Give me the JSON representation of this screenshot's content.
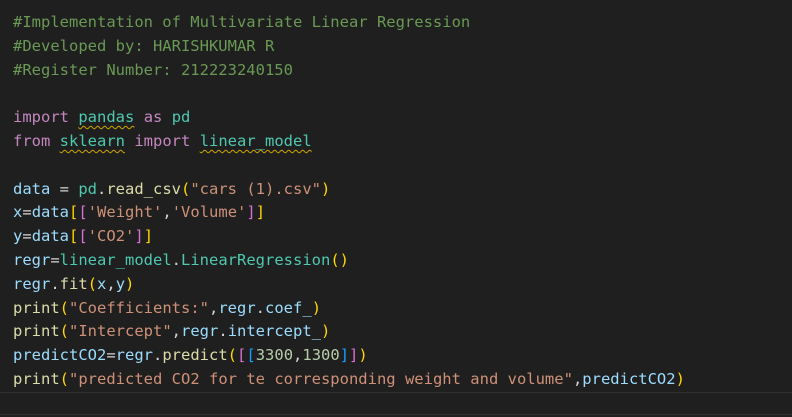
{
  "editor": {
    "lines": [
      [
        {
          "t": "#Implementation of Multivariate Linear Regression",
          "c": "comment"
        }
      ],
      [
        {
          "t": "#Developed by: HARISHKUMAR R",
          "c": "comment"
        }
      ],
      [
        {
          "t": "#Register Number: 212223240150",
          "c": "comment"
        }
      ],
      [],
      [
        {
          "t": "import",
          "c": "keyword"
        },
        {
          "t": " ",
          "c": "plain"
        },
        {
          "t": "pandas",
          "c": "module",
          "w": true
        },
        {
          "t": " ",
          "c": "plain"
        },
        {
          "t": "as",
          "c": "keyword"
        },
        {
          "t": " ",
          "c": "plain"
        },
        {
          "t": "pd",
          "c": "module"
        }
      ],
      [
        {
          "t": "from",
          "c": "keyword"
        },
        {
          "t": " ",
          "c": "plain"
        },
        {
          "t": "sklearn",
          "c": "module",
          "w": true
        },
        {
          "t": " ",
          "c": "plain"
        },
        {
          "t": "import",
          "c": "keyword"
        },
        {
          "t": " ",
          "c": "plain"
        },
        {
          "t": "linear_model",
          "c": "module",
          "w": true
        }
      ],
      [],
      [
        {
          "t": "data",
          "c": "var"
        },
        {
          "t": " = ",
          "c": "plain"
        },
        {
          "t": "pd",
          "c": "module"
        },
        {
          "t": ".",
          "c": "plain"
        },
        {
          "t": "read_csv",
          "c": "func"
        },
        {
          "t": "(",
          "c": "br1"
        },
        {
          "t": "\"cars (1).csv\"",
          "c": "string"
        },
        {
          "t": ")",
          "c": "br1"
        }
      ],
      [
        {
          "t": "x",
          "c": "var"
        },
        {
          "t": "=",
          "c": "plain"
        },
        {
          "t": "data",
          "c": "var"
        },
        {
          "t": "[",
          "c": "br1"
        },
        {
          "t": "[",
          "c": "br2"
        },
        {
          "t": "'Weight'",
          "c": "string"
        },
        {
          "t": ",",
          "c": "plain"
        },
        {
          "t": "'Volume'",
          "c": "string"
        },
        {
          "t": "]",
          "c": "br2"
        },
        {
          "t": "]",
          "c": "br1"
        }
      ],
      [
        {
          "t": "y",
          "c": "var"
        },
        {
          "t": "=",
          "c": "plain"
        },
        {
          "t": "data",
          "c": "var"
        },
        {
          "t": "[",
          "c": "br1"
        },
        {
          "t": "[",
          "c": "br2"
        },
        {
          "t": "'CO2'",
          "c": "string"
        },
        {
          "t": "]",
          "c": "br2"
        },
        {
          "t": "]",
          "c": "br1"
        }
      ],
      [
        {
          "t": "regr",
          "c": "var"
        },
        {
          "t": "=",
          "c": "plain"
        },
        {
          "t": "linear_model",
          "c": "module"
        },
        {
          "t": ".",
          "c": "plain"
        },
        {
          "t": "LinearRegression",
          "c": "module"
        },
        {
          "t": "()",
          "c": "br1"
        }
      ],
      [
        {
          "t": "regr",
          "c": "var"
        },
        {
          "t": ".",
          "c": "plain"
        },
        {
          "t": "fit",
          "c": "func"
        },
        {
          "t": "(",
          "c": "br1"
        },
        {
          "t": "x",
          "c": "var"
        },
        {
          "t": ",",
          "c": "plain"
        },
        {
          "t": "y",
          "c": "var"
        },
        {
          "t": ")",
          "c": "br1"
        }
      ],
      [
        {
          "t": "print",
          "c": "func"
        },
        {
          "t": "(",
          "c": "br1"
        },
        {
          "t": "\"Coefficients:\"",
          "c": "string"
        },
        {
          "t": ",",
          "c": "plain"
        },
        {
          "t": "regr",
          "c": "var"
        },
        {
          "t": ".",
          "c": "plain"
        },
        {
          "t": "coef_",
          "c": "var"
        },
        {
          "t": ")",
          "c": "br1"
        }
      ],
      [
        {
          "t": "print",
          "c": "func"
        },
        {
          "t": "(",
          "c": "br1"
        },
        {
          "t": "\"Intercept\"",
          "c": "string"
        },
        {
          "t": ",",
          "c": "plain"
        },
        {
          "t": "regr",
          "c": "var"
        },
        {
          "t": ".",
          "c": "plain"
        },
        {
          "t": "intercept_",
          "c": "var"
        },
        {
          "t": ")",
          "c": "br1"
        }
      ],
      [
        {
          "t": "predictCO2",
          "c": "var"
        },
        {
          "t": "=",
          "c": "plain"
        },
        {
          "t": "regr",
          "c": "var"
        },
        {
          "t": ".",
          "c": "plain"
        },
        {
          "t": "predict",
          "c": "func"
        },
        {
          "t": "(",
          "c": "br1"
        },
        {
          "t": "[",
          "c": "br2"
        },
        {
          "t": "[",
          "c": "br3"
        },
        {
          "t": "3300",
          "c": "number"
        },
        {
          "t": ",",
          "c": "plain"
        },
        {
          "t": "1300",
          "c": "number"
        },
        {
          "t": "]",
          "c": "br3"
        },
        {
          "t": "]",
          "c": "br2"
        },
        {
          "t": ")",
          "c": "br1"
        }
      ],
      [
        {
          "t": "print",
          "c": "func"
        },
        {
          "t": "(",
          "c": "br1"
        },
        {
          "t": "\"predicted CO2 for te corresponding weight and volume\"",
          "c": "string"
        },
        {
          "t": ",",
          "c": "plain"
        },
        {
          "t": "predictCO2",
          "c": "var"
        },
        {
          "t": ")",
          "c": "br1"
        }
      ]
    ]
  },
  "theme": {
    "background": "#1f1f1f",
    "comment": "#6a9955",
    "keyword": "#c586c0",
    "module": "#4ec9b0",
    "variable": "#9cdcfe",
    "function": "#dcdcaa",
    "string": "#ce9178",
    "number": "#b5cea8",
    "bracket_level1": "#ffd700",
    "bracket_level2": "#da70d6",
    "bracket_level3": "#179fff",
    "warning_squiggle": "#cca700"
  }
}
